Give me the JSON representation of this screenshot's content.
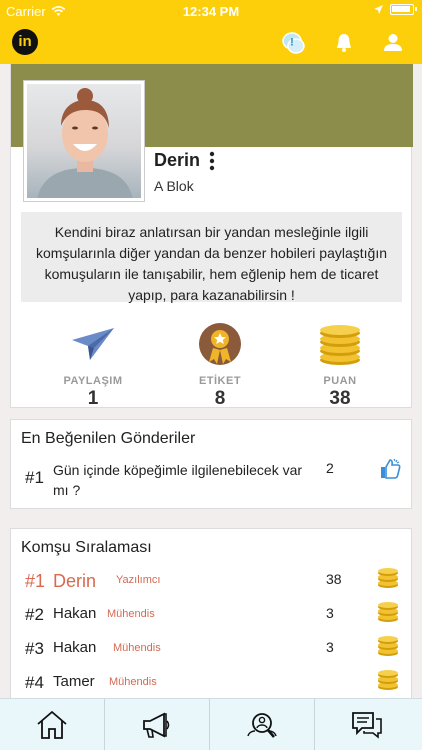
{
  "status_bar": {
    "carrier": "Carrier",
    "time": "12:34 PM"
  },
  "app": {
    "logo_text": "in"
  },
  "profile": {
    "name": "Derin",
    "block": "A Blok",
    "bio": "Kendini biraz anlatırsan bir yandan mesleğinle ilgili komşularınla diğer yandan da benzer hobileri paylaştığın komuşuların ile tanışabilir, hem eğlenip hem de ticaret yapıp, para kazanabilirsin !"
  },
  "stats": [
    {
      "label": "PAYLAŞIM",
      "value": "1",
      "icon": "paper-plane-icon"
    },
    {
      "label": "ETİKET",
      "value": "8",
      "icon": "medal-icon"
    },
    {
      "label": "PUAN",
      "value": "38",
      "icon": "coins-icon"
    }
  ],
  "top_posts": {
    "title": "En Beğenilen Gönderiler",
    "items": [
      {
        "rank": "#1",
        "text": "Gün içinde köpeğimle ilgilenebilecek var mı ?",
        "likes": "2"
      }
    ]
  },
  "ranking": {
    "title": "Komşu Sıralaması",
    "rows": [
      {
        "rank": "#1",
        "name": "Derin",
        "profession": "Yazılımcı",
        "points": "38"
      },
      {
        "rank": "#2",
        "name": "Hakan",
        "profession": "Mühendis",
        "points": "3"
      },
      {
        "rank": "#3",
        "name": "Hakan",
        "profession": "Mühendis",
        "points": "3"
      },
      {
        "rank": "#4",
        "name": "Tamer",
        "profession": "Mühendis",
        "points": ""
      }
    ]
  },
  "tabs": [
    "home-icon",
    "megaphone-icon",
    "search-people-icon",
    "chat-icon"
  ],
  "colors": {
    "brand_yellow": "#fccf0a",
    "cover_olive": "#8c8c4b",
    "accent_red": "#d9694f",
    "tab_blue": "#e9f6fa"
  }
}
